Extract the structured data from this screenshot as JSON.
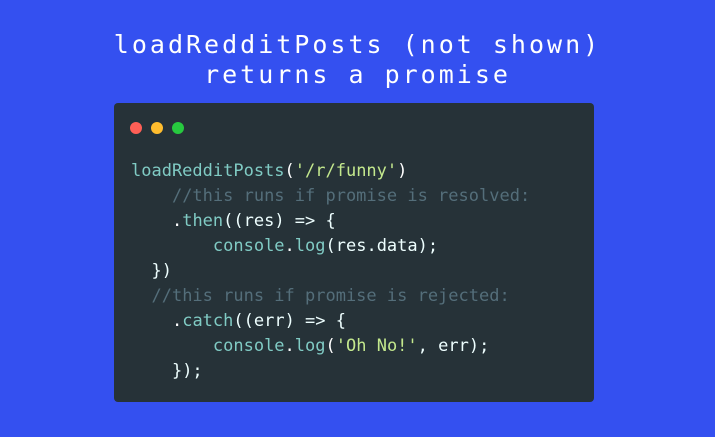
{
  "headline": {
    "line1": "loadRedditPosts (not shown)",
    "line2": "returns a promise"
  },
  "window": {
    "controls": [
      "close",
      "minimize",
      "maximize"
    ],
    "colors": {
      "background": "#263238",
      "page": "#3450f0",
      "close": "#ff5f56",
      "minimize": "#ffbd2e",
      "maximize": "#27c93f"
    }
  },
  "code": {
    "l1_fn": "loadRedditPosts",
    "l1_open": "(",
    "l1_str": "'/r/funny'",
    "l1_close": ")",
    "l2_indent": "    ",
    "l2_comment": "//this runs if promise is resolved:",
    "l3_indent": "    ",
    "l3_dot": ".",
    "l3_method": "then",
    "l3_args": "((res) => {",
    "l4_indent": "        ",
    "l4_obj": "console",
    "l4_dot": ".",
    "l4_method": "log",
    "l4_args": "(res.data);",
    "l5_indent": "  ",
    "l5_text": "})",
    "l6_indent": "  ",
    "l6_comment": "//this runs if promise is rejected:",
    "l7_indent": "    ",
    "l7_dot": ".",
    "l7_method": "catch",
    "l7_args": "((err) => {",
    "l8_indent": "        ",
    "l8_obj": "console",
    "l8_dot": ".",
    "l8_method": "log",
    "l8_open": "(",
    "l8_str": "'Oh No!'",
    "l8_rest": ", err);",
    "l9_indent": "    ",
    "l9_text": "});"
  }
}
